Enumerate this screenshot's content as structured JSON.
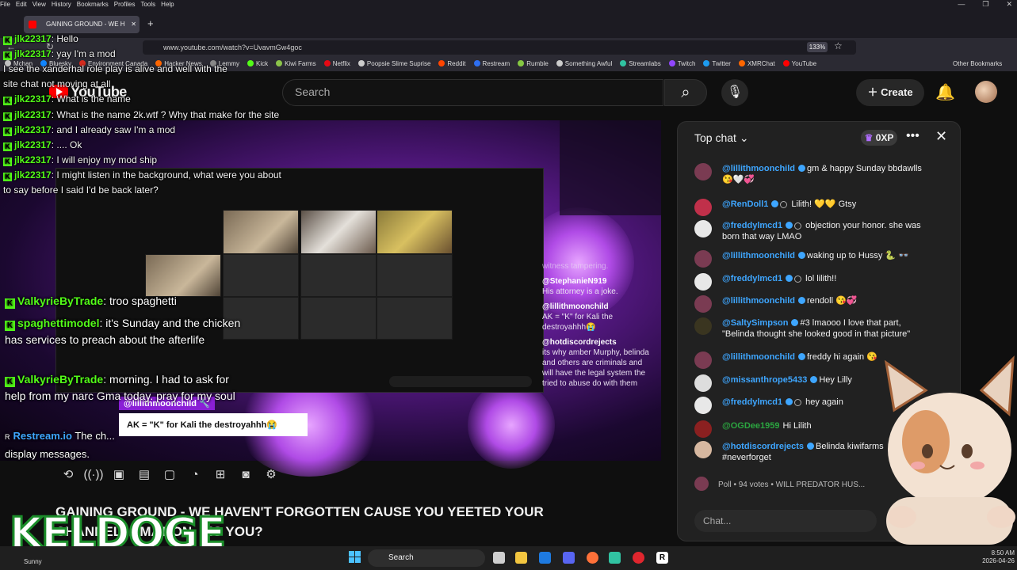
{
  "menubar": {
    "items": [
      "File",
      "Edit",
      "View",
      "History",
      "Bookmarks",
      "Profiles",
      "Tools",
      "Help"
    ]
  },
  "window_controls": [
    "—",
    "❐",
    "✕"
  ],
  "tab": {
    "title": "GAINING GROUND - WE H",
    "close": "✕",
    "new": "+"
  },
  "url": "www.youtube.com/watch?v=UvavmGw4goc",
  "zoom": "133%",
  "bookmarks": [
    {
      "label": "Mchan",
      "color": "#c0c0c0"
    },
    {
      "label": "Bluesky",
      "color": "#1185fe"
    },
    {
      "label": "Environment Canada",
      "color": "#d52b1e"
    },
    {
      "label": "Hacker News",
      "color": "#ff6600"
    },
    {
      "label": "Lemmy",
      "color": "#888888"
    },
    {
      "label": "Kick",
      "color": "#53fc18"
    },
    {
      "label": "Kiwi Farms",
      "color": "#8bc34a"
    },
    {
      "label": "Netflix",
      "color": "#e50914"
    },
    {
      "label": "Poopsie Slime Suprise",
      "color": "#cccccc"
    },
    {
      "label": "Reddit",
      "color": "#ff4500"
    },
    {
      "label": "Restream",
      "color": "#2e6ff2"
    },
    {
      "label": "Rumble",
      "color": "#85c742"
    },
    {
      "label": "Something Awful",
      "color": "#cccccc"
    },
    {
      "label": "Streamlabs",
      "color": "#31c3a2"
    },
    {
      "label": "Twitch",
      "color": "#9146ff"
    },
    {
      "label": "Twitter",
      "color": "#1d9bf0"
    },
    {
      "label": "XMRChat",
      "color": "#ff6600"
    },
    {
      "label": "YouTube",
      "color": "#ff0000"
    }
  ],
  "other_bookmarks": "Other Bookmarks",
  "youtube": {
    "logo": "YouTube",
    "search_placeholder": "Search",
    "create": "Create"
  },
  "overlay_chat": [
    {
      "user": "jlk22317",
      "text": "Hello"
    },
    {
      "user": "jlk22317",
      "text": "yay I'm a mod"
    },
    {
      "user": "",
      "text": "I see the xanderhal role play is alive and well with the"
    },
    {
      "user": "",
      "text": "site chat not moving at all"
    },
    {
      "user": "jlk22317",
      "text": "What is the name"
    },
    {
      "user": "jlk22317",
      "text": "What is the name 2k.wtf ? Why that make for the site"
    },
    {
      "user": "jlk22317",
      "text": "and I already saw I'm a mod"
    },
    {
      "user": "jlk22317",
      "text": ".... Ok"
    },
    {
      "user": "jlk22317",
      "text": "I will enjoy my mod ship"
    },
    {
      "user": "jlk22317",
      "text": "I might listen in the background, what were you about"
    },
    {
      "user": "",
      "text": "to say before I said I'd be back later?"
    }
  ],
  "stream_chat": [
    {
      "user": "ValkyrieByTrade",
      "text": "troo spaghetti"
    },
    {
      "user": "spaghettimodel",
      "text": "it's Sunday and the chicken has services to preach about the afterlife"
    },
    {
      "user": "ValkyrieByTrade",
      "text": "morning. I had to ask for help from my narc Gma today. pray for my soul"
    },
    {
      "user": "Restream.io",
      "text": "The ch... display messages."
    }
  ],
  "video_overlay_chat": [
    {
      "user": "",
      "text": "witness tampering."
    },
    {
      "user": "@StephanieN919",
      "text": "His attorney is a joke."
    },
    {
      "user": "@lillithmoonchild",
      "text": "AK = \"K\" for Kali the destroyahhh😭"
    },
    {
      "user": "@hotdiscordrejects",
      "text": "its why amber Murphy, belinda and others are criminals and will have the legal system the tried to abuse do with them"
    }
  ],
  "caption": {
    "user": "@lillithmoonchild 🔧",
    "text": "AK = \"K\" for Kali the destroyahhh😭"
  },
  "video_title": "GAINING GROUND - WE HAVEN'T FORGOTTEN CAUSE YOU YEETED YOUR CHANNEL ... MATION, DIS YOU?",
  "watermark": "KELDOGE",
  "live_chat": {
    "header": "Top chat",
    "xp": "0XP",
    "messages": [
      {
        "user": "@lillithmoonchild",
        "text": "gm & happy Sunday bbdawlls 😘🤍💞",
        "avatar": "#7a3b52"
      },
      {
        "user": "@RenDoll1",
        "text": "Lilith! 💛💛 Gtsy",
        "avatar": "#c0304a"
      },
      {
        "user": "@freddylmcd1",
        "text": "objection your honor. she was born that way LMAO",
        "avatar": "#e8e8e8"
      },
      {
        "user": "@lillithmoonchild",
        "text": "waking up to Hussy 🐍 👓",
        "avatar": "#7a3b52"
      },
      {
        "user": "@freddylmcd1",
        "text": "lol lilith!!",
        "avatar": "#e8e8e8"
      },
      {
        "user": "@lillithmoonchild",
        "text": "rendoll 😘💞",
        "avatar": "#7a3b52"
      },
      {
        "user": "@SaltySimpson",
        "text": "#3  lmaooo I love that part, \"Belinda thought she looked good in that picture\"",
        "avatar": "#3a3520"
      },
      {
        "user": "@lillithmoonchild",
        "text": "freddy hi again 😘",
        "avatar": "#7a3b52"
      },
      {
        "user": "@missanthrope5433",
        "text": "Hey Lilly",
        "avatar": "#dddddd"
      },
      {
        "user": "@freddylmcd1",
        "text": "hey again",
        "avatar": "#e8e8e8"
      },
      {
        "user": "@OGDee1959",
        "text": "Hi Lilith",
        "avatar": "#8b2020"
      },
      {
        "user": "@hotdiscordrejects",
        "text": "Belinda kiwifarms #neverforget",
        "avatar": "#d7b8a0"
      }
    ],
    "poll": "Poll • 94 votes • WILL PREDATOR HUS...",
    "input_placeholder": "Chat..."
  },
  "taskbar": {
    "search": "Search",
    "weather": "Sunny",
    "time": "8:50 AM",
    "date": "2026-04-26"
  }
}
